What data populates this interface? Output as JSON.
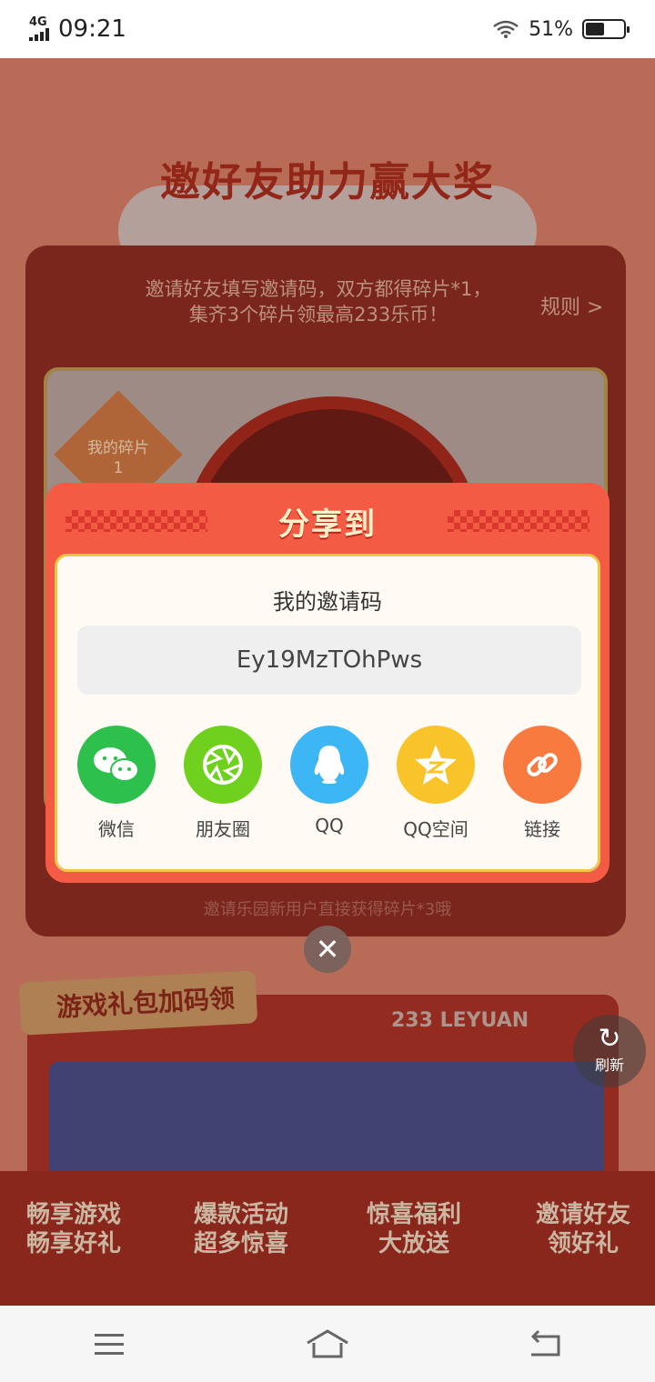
{
  "status_bar": {
    "network": "4G",
    "time": "09:21",
    "battery_percent": "51%",
    "battery_level": 0.51
  },
  "background_page": {
    "title": "邀好友助力赢大奖",
    "banner_text": "邀请好友填写邀请码，双方都得碎片*1，集齐3个碎片领最高233乐币！",
    "rules_link": "规则 >",
    "my_fragments_label": "我的碎片",
    "my_fragments_count": "1",
    "footer_hint": "邀请乐园新用户直接获得碎片*3哦",
    "gift_section_title": "游戏礼包加码领",
    "brand_text": "233 LEYUAN",
    "promo_items": [
      {
        "line1": "畅享游戏",
        "line2": "畅享好礼"
      },
      {
        "line1": "爆款活动",
        "line2": "超多惊喜"
      },
      {
        "line1": "惊喜福利",
        "line2": "大放送"
      },
      {
        "line1": "邀请好友",
        "line2": "领好礼"
      }
    ]
  },
  "refresh_button": {
    "label": "刷新",
    "icon": "refresh-icon"
  },
  "share_modal": {
    "title": "分享到",
    "invite_code_label": "我的邀请码",
    "invite_code": "Ey19MzTOhPws",
    "share_targets": [
      {
        "label": "微信",
        "icon": "wechat-icon",
        "color": "#2dc04c"
      },
      {
        "label": "朋友圈",
        "icon": "moments-icon",
        "color": "#6fd11e"
      },
      {
        "label": "QQ",
        "icon": "qq-icon",
        "color": "#3db6f5"
      },
      {
        "label": "QQ空间",
        "icon": "qzone-icon",
        "color": "#f8c42a"
      },
      {
        "label": "链接",
        "icon": "link-icon",
        "color": "#f97a3f"
      }
    ]
  },
  "colors": {
    "modal_red": "#f35b45",
    "modal_border_gold": "#f2c544",
    "page_bg": "#d27a63"
  }
}
